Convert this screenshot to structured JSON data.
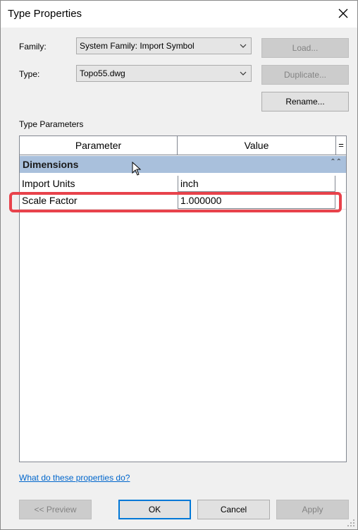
{
  "window": {
    "title": "Type Properties"
  },
  "family": {
    "label": "Family:",
    "value": "System Family: Import Symbol"
  },
  "type": {
    "label": "Type:",
    "value": "Topo55.dwg"
  },
  "buttons": {
    "load": "Load...",
    "duplicate": "Duplicate...",
    "rename": "Rename...",
    "preview": "<< Preview",
    "ok": "OK",
    "cancel": "Cancel",
    "apply": "Apply"
  },
  "type_parameters": {
    "label": "Type Parameters",
    "columns": {
      "parameter": "Parameter",
      "value": "Value",
      "sort": "="
    },
    "section": {
      "name": "Dimensions",
      "collapse": "⌃⌃"
    },
    "rows": [
      {
        "parameter": "Import Units",
        "value": "inch"
      },
      {
        "parameter": "Scale Factor",
        "value": "1.000000"
      }
    ]
  },
  "help_link": "What do these properties do?",
  "colors": {
    "highlight": "#e8424b",
    "section": "#a9c0dc",
    "link": "#0066cc"
  }
}
